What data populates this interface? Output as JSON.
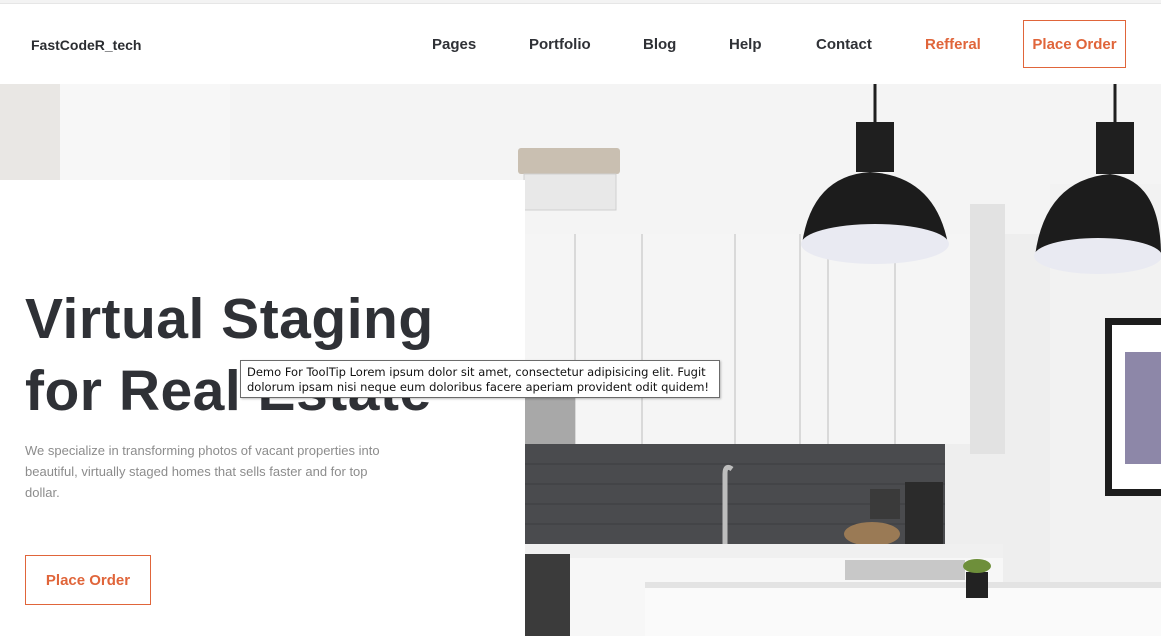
{
  "header": {
    "brand": "FastCodeR_tech",
    "nav": [
      {
        "label": "Pages"
      },
      {
        "label": "Portfolio"
      },
      {
        "label": "Blog"
      },
      {
        "label": "Help"
      },
      {
        "label": "Contact"
      },
      {
        "label": "Refferal"
      }
    ],
    "cta_label": "Place Order"
  },
  "hero": {
    "title_line1": "Virtual Staging",
    "title_line2": "for Real Estate",
    "description": "We specialize in transforming photos of vacant properties into beautiful, virtually staged homes that sells faster and for top dollar.",
    "cta_label": "Place Order",
    "image_alt": "kitchen-photo"
  },
  "tooltip": {
    "text": "Demo For ToolTip Lorem ipsum dolor sit amet, consectetur adipisicing elit. Fugit dolorum ipsam nisi neque eum doloribus facere aperiam provident odit quidem!"
  },
  "colors": {
    "accent": "#e0653a",
    "heading": "#2f3136",
    "body_text": "#8c8c8c"
  }
}
